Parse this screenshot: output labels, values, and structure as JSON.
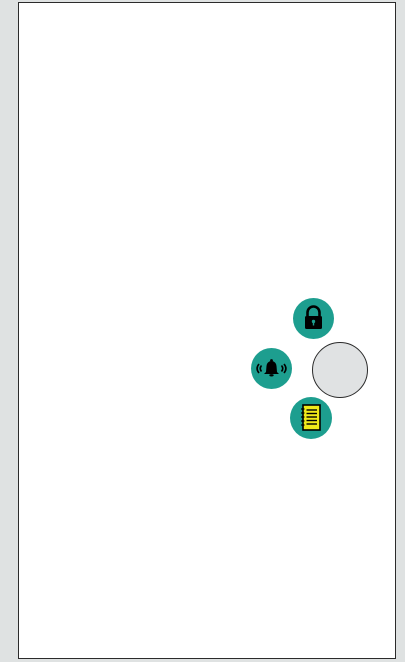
{
  "colors": {
    "background": "#dfe2e2",
    "screen": "#ffffff",
    "fab_teal": "#1d9e8f",
    "main_fab": "#e0e2e3",
    "notes_yellow": "#f0ea1a"
  },
  "fab_menu": {
    "main": {
      "icon": "menu-toggle"
    },
    "items": [
      {
        "icon": "lock-icon"
      },
      {
        "icon": "bell-ringing-icon"
      },
      {
        "icon": "notebook-icon"
      }
    ]
  }
}
